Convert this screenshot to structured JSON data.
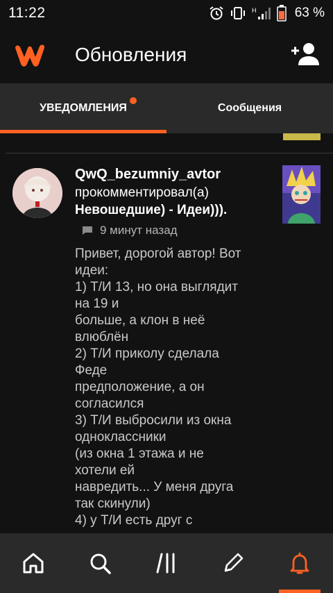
{
  "status_bar": {
    "time": "11:22",
    "battery_percent": "63 %",
    "icons": [
      "alarm-icon",
      "vibrate-icon",
      "signal-icon",
      "battery-icon"
    ]
  },
  "app_bar": {
    "title": "Обновления",
    "logo": "wattpad-logo",
    "action_icon": "add-user-icon"
  },
  "tabs": [
    {
      "label": "УВЕДОМЛЕНИЯ",
      "active": true,
      "has_badge": true
    },
    {
      "label": "Сообщения",
      "active": false,
      "has_badge": false
    }
  ],
  "notification": {
    "username": "QwQ_bezumniy_avtor",
    "action": "прокомментировал(а)",
    "story_title": "Невошедшие) - Идеи))).",
    "time_ago": "9 минут назад",
    "comment_lines": [
      "Привет, дорогой автор! Вот",
      "идеи:",
      "1) Т/И 13, но она выглядит",
      "на 19 и",
      "больше, а клон в неё",
      "влюблён",
      "2) Т/И приколу сделала",
      "Феде",
      "предположение, а он",
      "согласился",
      "3) Т/И выбросили из окна",
      "одноклассники",
      "(из окна 1 этажа и не",
      "хотели ей",
      "навредить... У меня друга",
      "так скинули)",
      "4) у Т/И есть друг с"
    ]
  },
  "bottom_nav": [
    {
      "name": "home-icon",
      "active": false
    },
    {
      "name": "search-icon",
      "active": false
    },
    {
      "name": "library-icon",
      "active": false
    },
    {
      "name": "write-icon",
      "active": false
    },
    {
      "name": "notifications-bell-icon",
      "active": true
    }
  ],
  "colors": {
    "accent": "#ff6122",
    "background": "#121212",
    "surface": "#2a2a2a"
  }
}
